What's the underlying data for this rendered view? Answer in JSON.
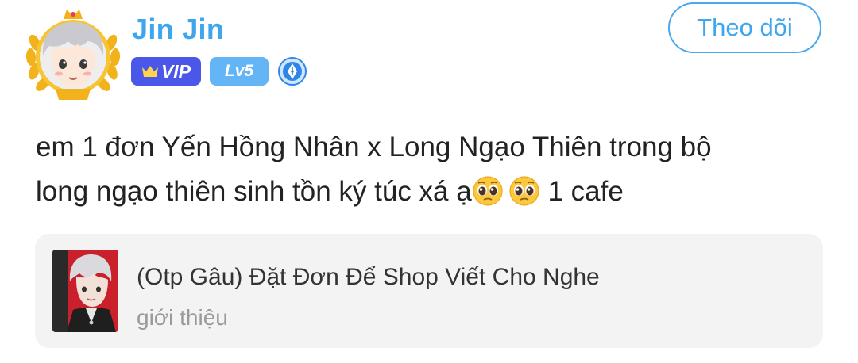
{
  "user": {
    "name": "Jin Jin",
    "avatar_icon": "anime-boy-avatar-with-gold-vip-frame",
    "avatar_frame_label": "VIP"
  },
  "badges": {
    "vip_label": "VIP",
    "vip_color": "#4a57e8",
    "level_label": "Lv5",
    "level_color": "#64b5f6",
    "author_icon": "pen-nib-badge-icon"
  },
  "follow_button": {
    "label": "Theo dõi",
    "color": "#3da6ee"
  },
  "post": {
    "line1": "em 1 đơn Yến Hồng Nhân x Long Ngạo Thiên trong bộ",
    "line2_before": "long ngạo thiên sinh tồn ký túc xá ạ",
    "line2_after": " 1 cafe",
    "emoji": "pleading-face-emoji"
  },
  "linked_story": {
    "title": "(Otp Gâu) Đặt Đơn Để Shop Viết Cho Nghe",
    "subtitle": "giới thiệu",
    "thumbnail_icon": "anime-character-cover-thumbnail"
  }
}
